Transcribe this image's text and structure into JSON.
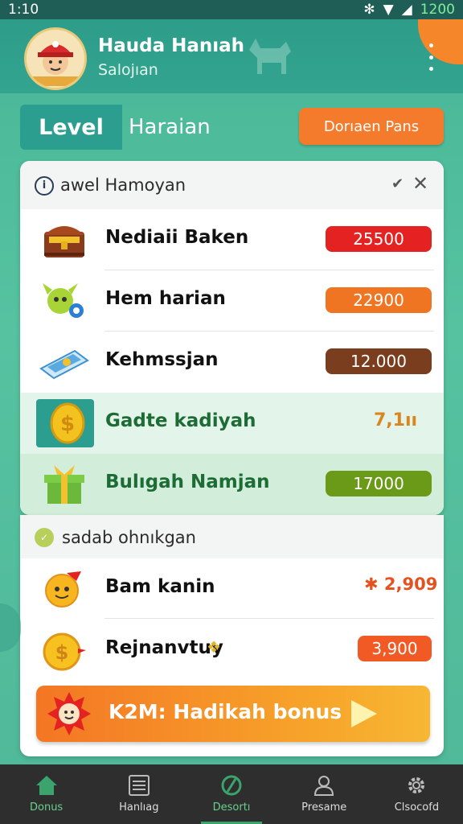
{
  "status": {
    "time": "1:10",
    "battery_text": "1200"
  },
  "header": {
    "title": "Hauda Hanıah",
    "subtitle": "Salojıan"
  },
  "tabs": {
    "level": "Level",
    "second": "Haraian",
    "action": "Dorıaen Pans"
  },
  "card1": {
    "title": "awel Hamoyan",
    "rows": [
      {
        "label": "Nediaii Baken",
        "value": "25500",
        "color": "#e52222"
      },
      {
        "label": "Hem harian",
        "value": "22900",
        "color": "#f07522"
      },
      {
        "label": "Kehmssjan",
        "value": "12.000",
        "color": "#7a3d1e"
      },
      {
        "label": "Gadte kadiyah",
        "value": "7,1ıı"
      },
      {
        "label": "Bulıgah Namjan",
        "value": "17000",
        "color": "#6a9a17"
      }
    ]
  },
  "card2": {
    "title": "sadab ohnıkgan",
    "rows": [
      {
        "label": "Bam kanin",
        "value": "2,909",
        "prefix": "✱"
      },
      {
        "label": "Rejnanvtuy",
        "value": "3,900"
      }
    ],
    "bonus_label": "K2M: Hadikah bonus"
  },
  "nav": [
    {
      "label": "Donus",
      "icon": "home-icon"
    },
    {
      "label": "Hanlıag",
      "icon": "list-icon"
    },
    {
      "label": "Desortı",
      "icon": "compass-icon"
    },
    {
      "label": "Presame",
      "icon": "person-icon"
    },
    {
      "label": "Clsocofd",
      "icon": "gear-icon"
    }
  ]
}
